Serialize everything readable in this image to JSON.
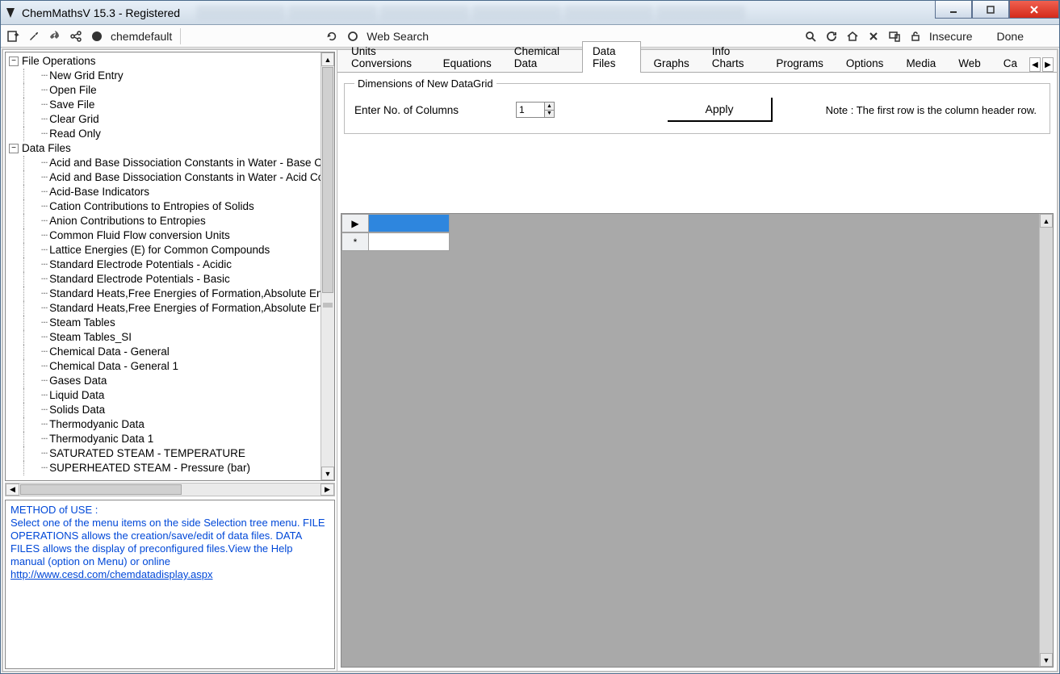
{
  "window": {
    "title": "ChemMathsV 15.3 - Registered"
  },
  "toolbar": {
    "profile": "chemdefault",
    "websearch": "Web Search",
    "insecure": "Insecure",
    "done": "Done"
  },
  "tree": {
    "root1": {
      "label": "File Operations",
      "expanded": true
    },
    "root1_items": [
      "New Grid Entry",
      "Open File",
      "Save File",
      "Clear Grid",
      "Read Only"
    ],
    "root2": {
      "label": "Data Files",
      "expanded": true
    },
    "root2_items": [
      "Acid and Base Dissociation Constants in Water - Base Co",
      "Acid and Base Dissociation Constants in Water - Acid Cor",
      "Acid-Base Indicators",
      "Cation Contributions to Entropies of Solids",
      "Anion Contributions to Entropies",
      "Common Fluid Flow conversion Units",
      "Lattice Energies (E) for Common Compounds",
      "Standard Electrode Potentials - Acidic",
      "Standard Electrode Potentials - Basic",
      "Standard Heats,Free Energies of Formation,Absolute Entr",
      "Standard Heats,Free Energies of Formation,Absolute Entr",
      "Steam Tables",
      "Steam Tables_SI",
      "Chemical Data - General",
      "Chemical Data - General 1",
      "Gases Data",
      "Liquid Data",
      "Solids Data",
      "Thermodyanic Data",
      "Thermodyanic Data 1",
      "SATURATED STEAM - TEMPERATURE",
      "SUPERHEATED STEAM - Pressure (bar)"
    ]
  },
  "help": {
    "heading": "METHOD of USE :",
    "body": "Select one of the menu items on the side Selection tree menu. FILE OPERATIONS allows the creation/save/edit of data files. DATA FILES allows the display of preconfigured files.View the Help manual (option on Menu) or online",
    "link": "http://www.cesd.com/chemdatadisplay.aspx"
  },
  "rtabs": [
    "Units Conversions",
    "Equations",
    "Chemical Data",
    "Data Files",
    "Graphs",
    "Info Charts",
    "Programs",
    "Options",
    "Media",
    "Web",
    "Ca"
  ],
  "rtab_active": 3,
  "dim": {
    "legend": "Dimensions of New DataGrid",
    "label": "Enter No. of Columns",
    "value": "1",
    "apply": "Apply",
    "note": "Note : The first row is the column header row."
  },
  "grid": {
    "row_marker": "▶",
    "new_marker": "*"
  }
}
